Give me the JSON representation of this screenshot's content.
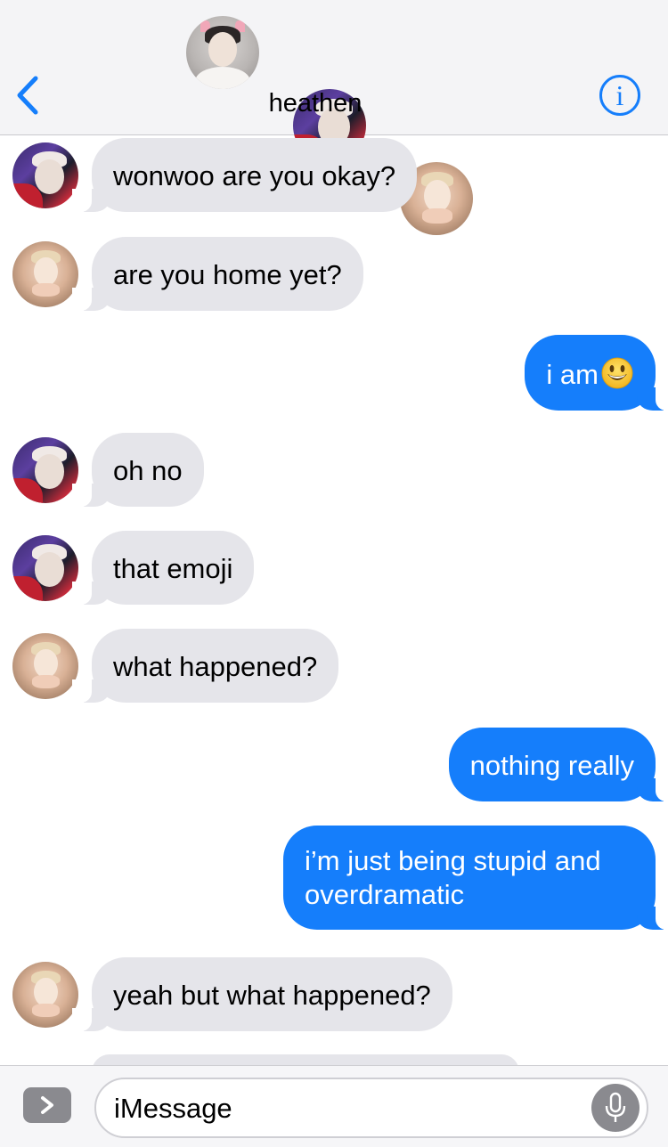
{
  "header": {
    "group_name": "heathen",
    "back_icon": "chevron-left-icon",
    "info_icon": "info-icon",
    "info_label": "i",
    "accent": "#157efb",
    "avatars": [
      "avatar-gray",
      "avatar-dark",
      "avatar-warm"
    ]
  },
  "messages": [
    {
      "direction": "incoming",
      "avatar": "dark",
      "text": "wonwoo are you okay?"
    },
    {
      "direction": "incoming",
      "avatar": "warm",
      "text": "are you home yet?"
    },
    {
      "direction": "outgoing",
      "text": "i am",
      "emoji": "smiling-face-emoji"
    },
    {
      "direction": "incoming",
      "avatar": "dark",
      "text": "oh no"
    },
    {
      "direction": "incoming",
      "avatar": "dark",
      "text": "that emoji"
    },
    {
      "direction": "incoming",
      "avatar": "warm",
      "text": "what happened?"
    },
    {
      "direction": "outgoing",
      "text": "nothing really"
    },
    {
      "direction": "outgoing",
      "text": "i’m just being stupid and overdramatic"
    },
    {
      "direction": "incoming",
      "avatar": "warm",
      "text": "yeah but what happened?"
    }
  ],
  "input_bar": {
    "placeholder": "iMessage",
    "apps_icon": "chevron-right-icon",
    "mic_icon": "microphone-icon"
  },
  "colors": {
    "outgoing_bubble": "#157efb",
    "incoming_bubble": "#e5e5ea"
  }
}
